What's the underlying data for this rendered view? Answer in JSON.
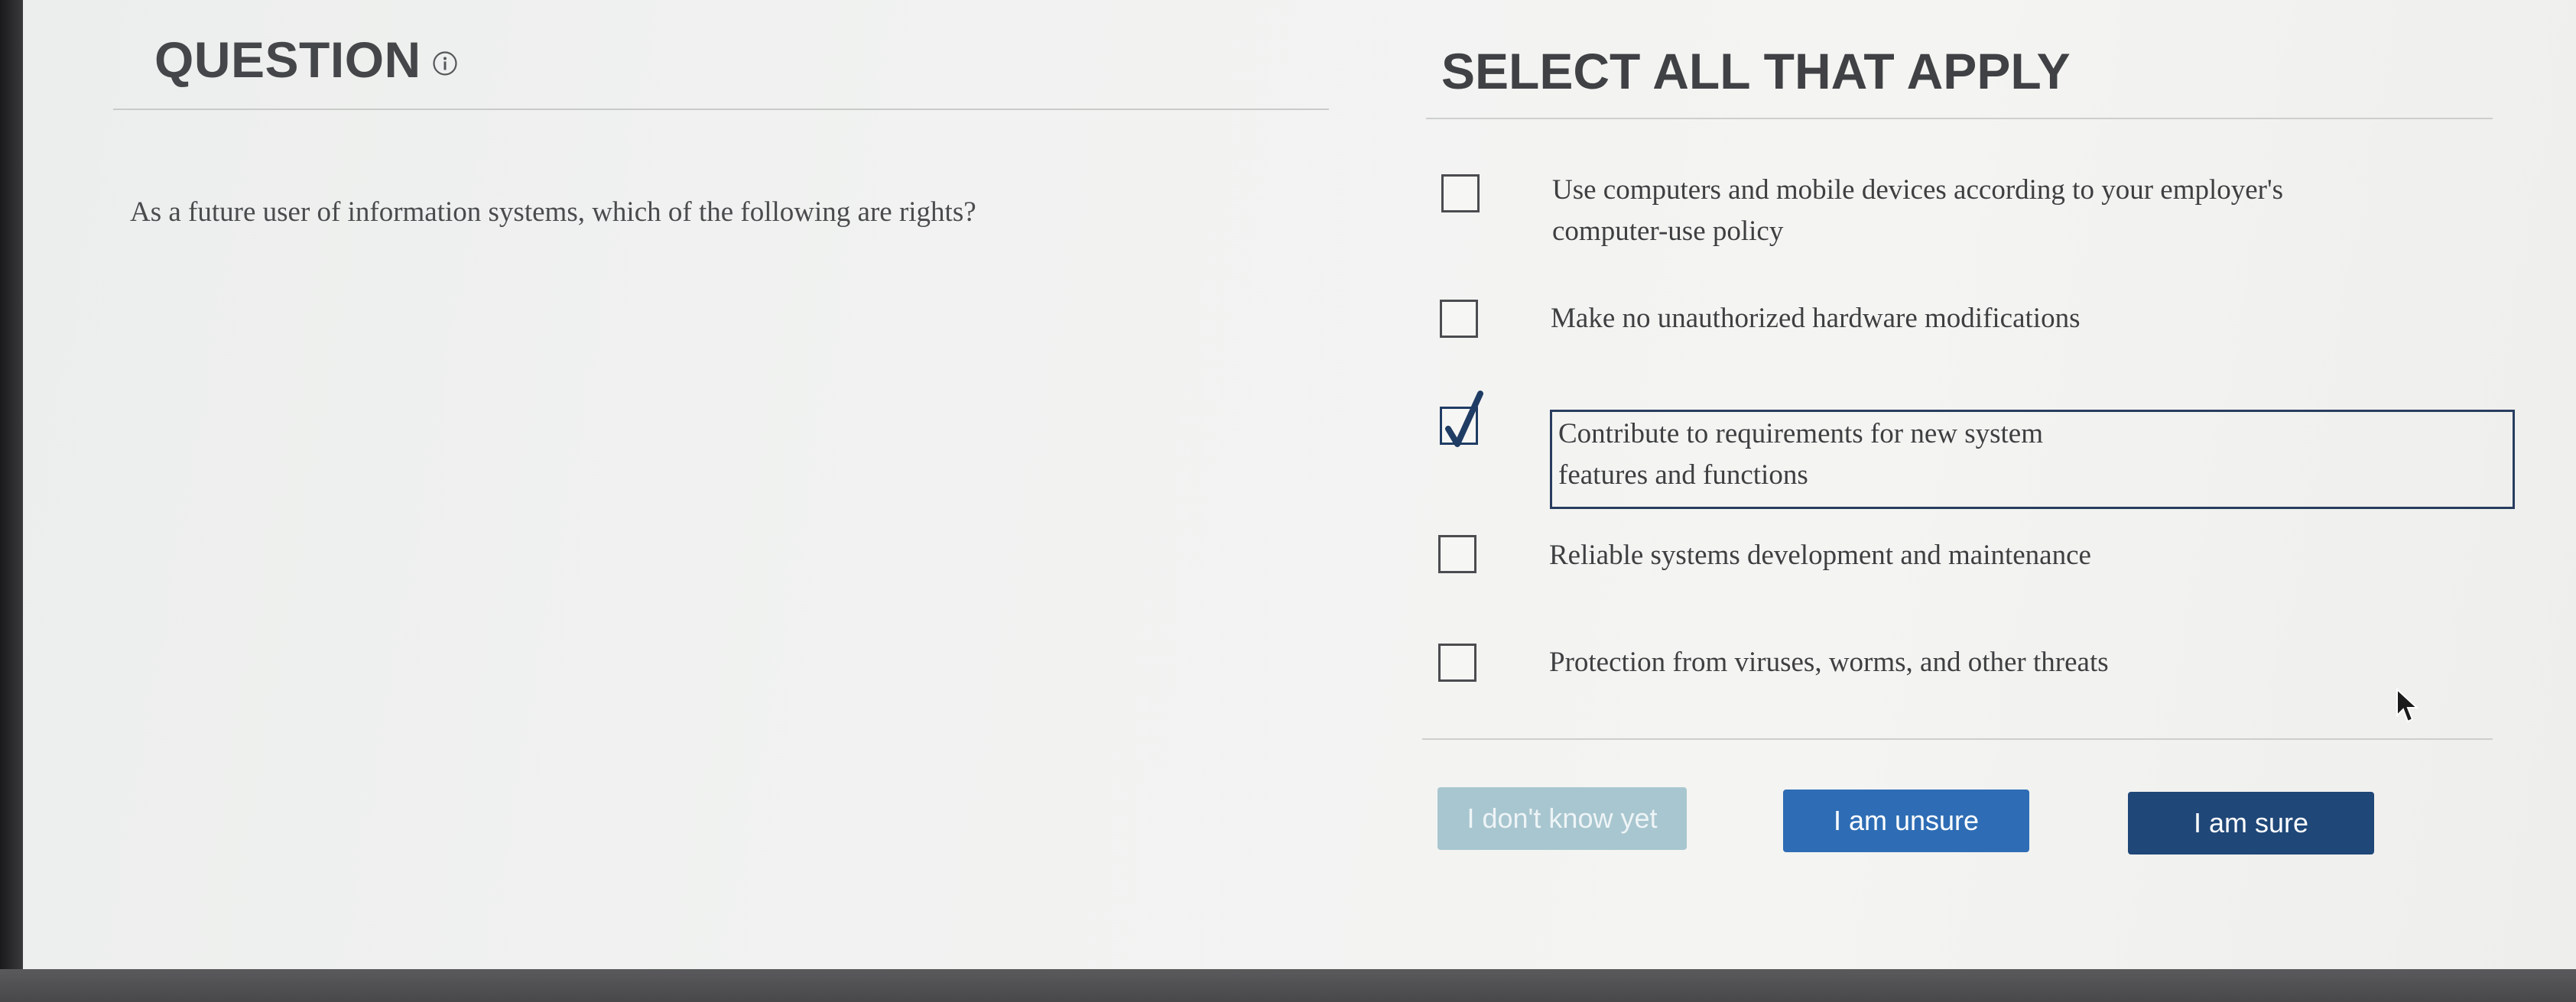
{
  "question": {
    "header": "QUESTION",
    "info_icon": "info-circle-icon",
    "text": "As a future user of information systems, which of the following are rights?"
  },
  "answers": {
    "header": "SELECT ALL THAT APPLY",
    "options": [
      {
        "lines": [
          "Use computers and mobile devices according to your employer's",
          "computer-use policy"
        ],
        "checked": false
      },
      {
        "lines": [
          "Make no unauthorized hardware modifications"
        ],
        "checked": false
      },
      {
        "lines": [
          "Contribute to requirements for new system",
          "features and functions"
        ],
        "checked": true
      },
      {
        "lines": [
          "Reliable systems development and maintenance"
        ],
        "checked": false
      },
      {
        "lines": [
          "Protection from viruses, worms, and other threats"
        ],
        "checked": false
      }
    ]
  },
  "buttons": {
    "dont_know": "I don't know yet",
    "unsure": "I am unsure",
    "sure": "I am sure"
  },
  "colors": {
    "dont_know_bg": "#a8c6cf",
    "unsure_bg": "#2e6db5",
    "sure_bg": "#1f4778",
    "check_color": "#1f3c64"
  }
}
